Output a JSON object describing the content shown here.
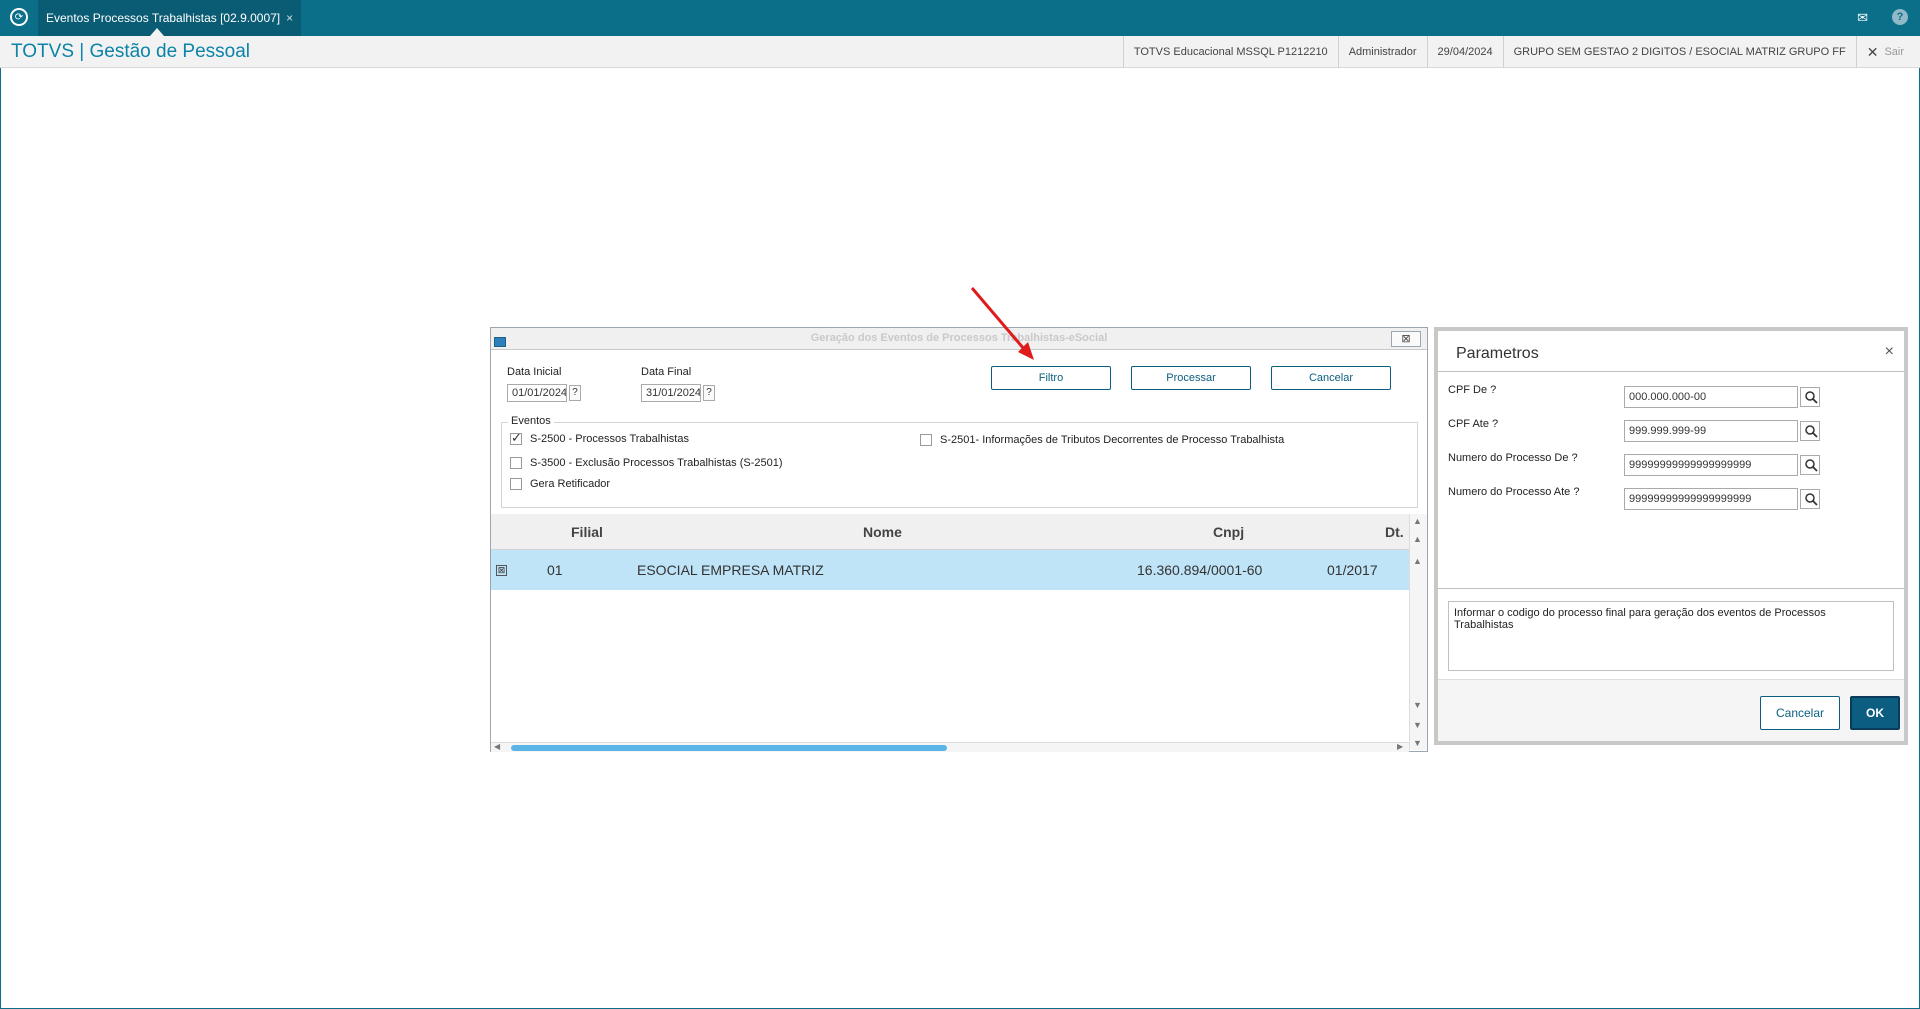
{
  "topbar": {
    "tab_label": "Eventos Processos Trabalhistas [02.9.0007]",
    "tab_close": "×",
    "mail_icon": "✉",
    "help_icon": "?"
  },
  "header": {
    "title": "TOTVS | Gestão de Pessoal",
    "environment": "TOTVS Educacional MSSQL P1212210",
    "user": "Administrador",
    "date": "29/04/2024",
    "group": "GRUPO SEM GESTAO 2 DIGITOS / ESOCIAL MATRIZ GRUPO FF",
    "logout_icon": "✕",
    "logout_label": "Sair"
  },
  "dialog": {
    "title": "Geração dos Eventos de Processos Trabalhistas-eSocial",
    "close_icon": "⊠",
    "data_inicial_label": "Data Inicial",
    "data_inicial_value": "01/01/2024",
    "data_final_label": "Data Final",
    "data_final_value": "31/01/2024",
    "help_q": "?",
    "buttons": {
      "filtro": "Filtro",
      "processar": "Processar",
      "cancelar": "Cancelar"
    },
    "eventos_legend": "Eventos",
    "checkboxes": [
      {
        "label": "S-2500 - Processos Trabalhistas",
        "checked": true
      },
      {
        "label": "S-3500 - Exclusão Processos Trabalhistas (S-2501)",
        "checked": false
      },
      {
        "label": "Gera Retificador",
        "checked": false
      },
      {
        "label": "S-2501- Informações de Tributos Decorrentes de Processo Trabalhista",
        "checked": false
      }
    ],
    "grid": {
      "columns": [
        "Filial",
        "Nome",
        "Cnpj",
        "Dt."
      ],
      "rows": [
        {
          "selected_icon": "⊠",
          "filial": "01",
          "nome": "ESOCIAL EMPRESA MATRIZ",
          "cnpj": "16.360.894/0001-60",
          "dt": "01/2017"
        }
      ]
    }
  },
  "params": {
    "title": "Parametros",
    "close_icon": "×",
    "fields": [
      {
        "label": "CPF De ?",
        "value": "000.000.000-00"
      },
      {
        "label": "CPF Ate ?",
        "value": "999.999.999-99"
      },
      {
        "label": "Numero do Processo De ?",
        "value": "99999999999999999999"
      },
      {
        "label": "Numero do Processo Ate ?",
        "value": "99999999999999999999"
      }
    ],
    "description": "Informar o codigo do processo final para geração dos eventos de Processos Trabalhistas",
    "cancel_label": "Cancelar",
    "ok_label": "OK"
  },
  "colors": {
    "brand": "#0b6f8a",
    "accent": "#0b84a8",
    "selected_row": "#bfe3f7",
    "annotation": "#e01b1b"
  }
}
